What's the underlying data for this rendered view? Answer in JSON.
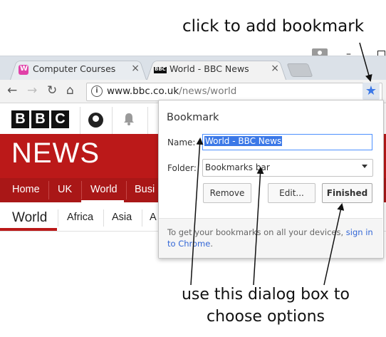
{
  "callouts": {
    "top": "click to add bookmark",
    "bottom": "use this dialog box to choose options"
  },
  "tabs": [
    {
      "title": "Computer Courses",
      "icon": "computer-courses-favicon"
    },
    {
      "title": "World - BBC News",
      "icon": "bbc-favicon"
    }
  ],
  "tab_close_glyph": "×",
  "window": {
    "minimize_glyph": "–"
  },
  "toolbar": {
    "back_glyph": "←",
    "forward_glyph": "→",
    "reload_glyph": "↻",
    "home_glyph": "⌂",
    "info_glyph": "i",
    "url_host": "www.bbc.co.uk",
    "url_path": "/news/world",
    "star_glyph": "★"
  },
  "page": {
    "logo_letters": [
      "B",
      "B",
      "C"
    ],
    "bell_glyph": "🔔",
    "banner_title": "NEWS",
    "nav": [
      "Home",
      "UK",
      "World",
      "Busi"
    ],
    "section_title": "World",
    "subnav": [
      "Africa",
      "Asia",
      "A"
    ]
  },
  "dialog": {
    "title": "Bookmark",
    "name_label": "Name:",
    "name_value": "World - BBC News",
    "folder_label": "Folder:",
    "folder_value": "Bookmarks bar",
    "remove_label": "Remove",
    "edit_label": "Edit...",
    "finished_label": "Finished",
    "footer_text": "To get your bookmarks on all your devices,",
    "footer_link": "sign in to Chrome",
    "footer_end": "."
  },
  "colors": {
    "bbc_red": "#bb1919",
    "star_blue": "#3b78e7",
    "selection_blue": "#3b78e7"
  }
}
